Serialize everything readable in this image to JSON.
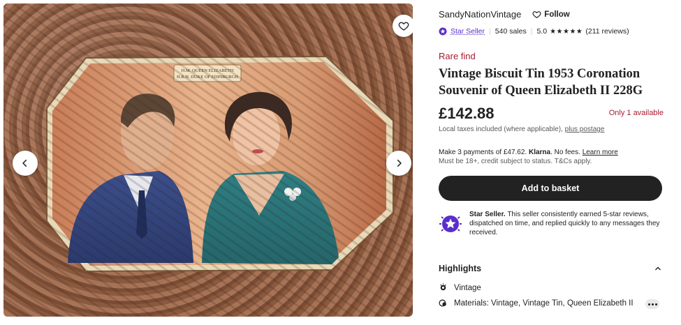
{
  "gallery": {
    "plaque_line1": "H.M. QUEEN ELIZABETH",
    "plaque_line2": "H.R.H. DUKE OF EDINBURGH",
    "prev_icon": "chevron-left-icon",
    "next_icon": "chevron-right-icon",
    "favorite_icon": "heart-icon"
  },
  "shop": {
    "name": "SandyNationVintage",
    "follow_label": "Follow"
  },
  "rating": {
    "star_seller_label": "Star Seller",
    "sales": "540 sales",
    "score": "5.0",
    "stars_value": 5,
    "reviews": "(211 reviews)"
  },
  "listing": {
    "badge": "Rare find",
    "title": "Vintage Biscuit Tin 1953 Coronation Souvenir of Queen Elizabeth II 228G",
    "price": "£142.88",
    "availability": "Only 1 available",
    "taxes_text": "Local taxes included (where applicable),",
    "postage_link": "plus postage"
  },
  "klarna": {
    "prefix": "Make 3 payments of £47.62.",
    "brand": "Klarna",
    "fees": "No fees.",
    "learn_more": "Learn more",
    "note": "Must be 18+, credit subject to status. T&Cs apply."
  },
  "actions": {
    "add_to_basket": "Add to basket"
  },
  "star_seller": {
    "heading": "Star Seller.",
    "body": "This seller consistently earned 5-star reviews, dispatched on time, and replied quickly to any messages they received."
  },
  "highlights": {
    "title": "Highlights",
    "items": [
      {
        "icon": "medal-icon",
        "text": "Vintage"
      },
      {
        "icon": "materials-icon",
        "text": "Materials: Vintage, Vintage Tin, Queen Elizabeth II"
      }
    ]
  },
  "colors": {
    "accent_red": "#a61a2e",
    "star_seller_purple": "#5a2ecb",
    "button_dark": "#222222"
  }
}
